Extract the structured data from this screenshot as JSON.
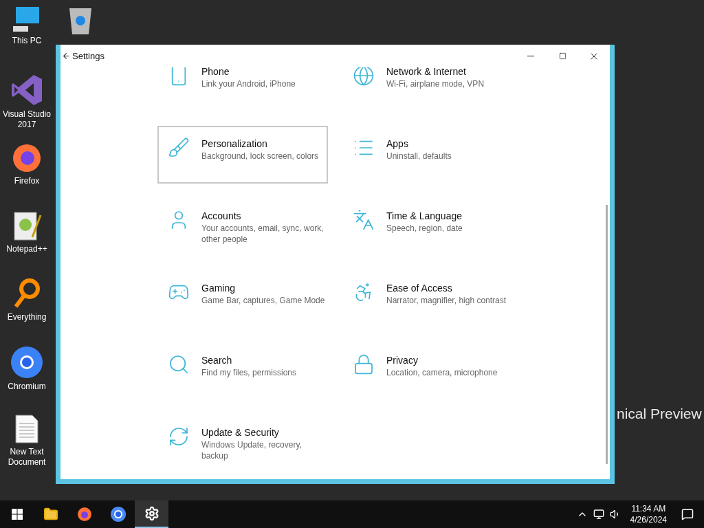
{
  "desktop": {
    "icons": [
      {
        "kind": "pc",
        "label": "This PC"
      },
      {
        "kind": "vs",
        "label": "Visual Studio 2017"
      },
      {
        "kind": "firefox",
        "label": "Firefox"
      },
      {
        "kind": "notepad",
        "label": "Notepad++"
      },
      {
        "kind": "everything",
        "label": "Everything"
      },
      {
        "kind": "chromium",
        "label": "Chromium"
      },
      {
        "kind": "textfile",
        "label": "New Text Document"
      }
    ],
    "background_text": "nical Preview"
  },
  "window": {
    "title": "Settings",
    "items": [
      {
        "kind": "phone",
        "title": "Phone",
        "description": "Link your Android, iPhone",
        "selected": false
      },
      {
        "kind": "globe",
        "title": "Network & Internet",
        "description": "Wi-Fi, airplane mode, VPN",
        "selected": false
      },
      {
        "kind": "paint",
        "title": "Personalization",
        "description": "Background, lock screen, colors",
        "selected": true
      },
      {
        "kind": "apps",
        "title": "Apps",
        "description": "Uninstall, defaults",
        "selected": false
      },
      {
        "kind": "user",
        "title": "Accounts",
        "description": "Your accounts, email, sync, work, other people",
        "selected": false
      },
      {
        "kind": "language",
        "title": "Time & Language",
        "description": "Speech, region, date",
        "selected": false
      },
      {
        "kind": "gamepad",
        "title": "Gaming",
        "description": "Game Bar, captures, Game Mode",
        "selected": false
      },
      {
        "kind": "ease",
        "title": "Ease of Access",
        "description": "Narrator, magnifier, high contrast",
        "selected": false
      },
      {
        "kind": "search",
        "title": "Search",
        "description": "Find my files, permissions",
        "selected": false
      },
      {
        "kind": "lock",
        "title": "Privacy",
        "description": "Location, camera, microphone",
        "selected": false
      },
      {
        "kind": "update",
        "title": "Update & Security",
        "description": "Windows Update, recovery, backup",
        "selected": false
      }
    ]
  },
  "taskbar": {
    "items": [
      {
        "kind": "start",
        "selected": false
      },
      {
        "kind": "explorer",
        "selected": false
      },
      {
        "kind": "firefox",
        "selected": false
      },
      {
        "kind": "chromium",
        "selected": false
      },
      {
        "kind": "settings",
        "selected": true
      }
    ],
    "time": "11:34 AM",
    "date": "4/26/2024"
  }
}
